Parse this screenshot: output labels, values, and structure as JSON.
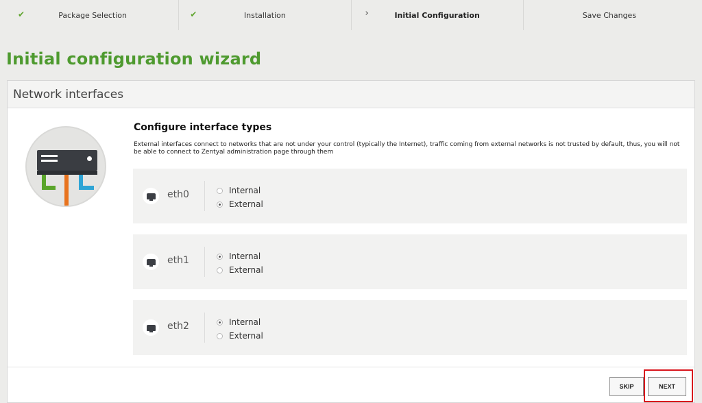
{
  "steps": [
    {
      "label": "Package Selection",
      "status": "done"
    },
    {
      "label": "Installation",
      "status": "done"
    },
    {
      "label": "Initial Configuration",
      "status": "current"
    },
    {
      "label": "Save Changes",
      "status": "pending"
    }
  ],
  "page_title": "Initial configuration wizard",
  "card": {
    "title": "Network interfaces",
    "section_title": "Configure interface types",
    "description": "External interfaces connect to networks that are not under your control (typically the Internet), traffic coming from external networks is not trusted by default, thus, you will not be able to connect to Zentyal administration page through them",
    "option_labels": {
      "internal": "Internal",
      "external": "External"
    },
    "interfaces": [
      {
        "name": "eth0",
        "selected": "External"
      },
      {
        "name": "eth1",
        "selected": "Internal"
      },
      {
        "name": "eth2",
        "selected": "Internal"
      }
    ]
  },
  "buttons": {
    "skip": "SKIP",
    "next": "NEXT"
  },
  "colors": {
    "title_green": "#4e9a2f",
    "check_green": "#5fa52e",
    "highlight_red": "#d8141c"
  }
}
